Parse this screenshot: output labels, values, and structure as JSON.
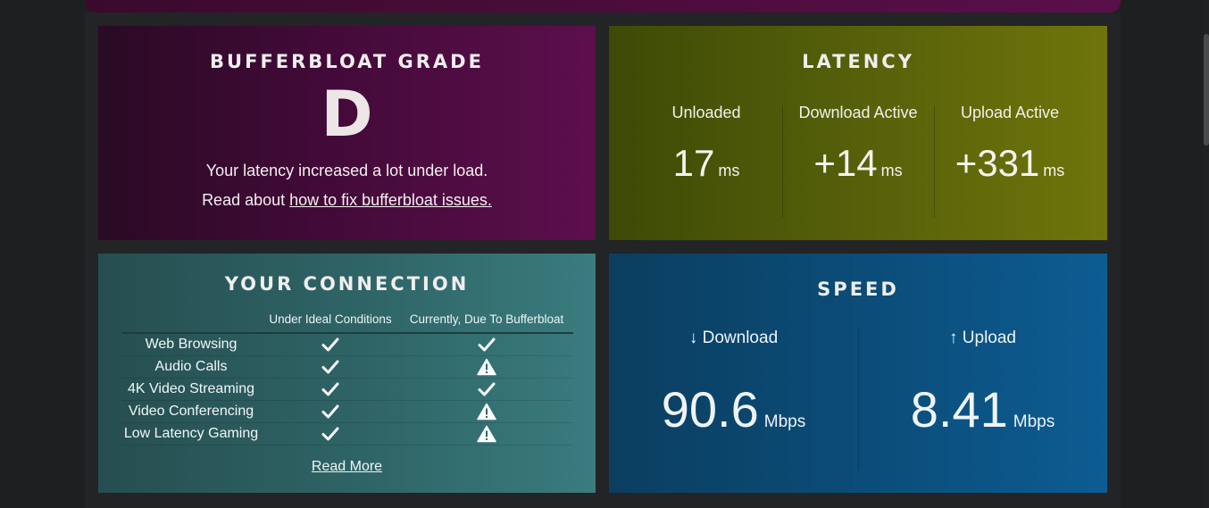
{
  "grade": {
    "title": "BUFFERBLOAT GRADE",
    "letter": "D",
    "description": "Your latency increased a lot under load.",
    "read_prefix": "Read about ",
    "read_link": "how to fix bufferbloat issues."
  },
  "latency": {
    "title": "LATENCY",
    "columns": [
      {
        "label": "Unloaded",
        "value": "17",
        "unit": "ms"
      },
      {
        "label": "Download Active",
        "value": "+14",
        "unit": "ms"
      },
      {
        "label": "Upload Active",
        "value": "+331",
        "unit": "ms"
      }
    ]
  },
  "connection": {
    "title": "YOUR CONNECTION",
    "headers": [
      "Under Ideal Conditions",
      "Currently, Due To Bufferbloat"
    ],
    "rows": [
      {
        "use": "Web Browsing",
        "ideal": "check-icon",
        "current": "check-icon"
      },
      {
        "use": "Audio Calls",
        "ideal": "check-icon",
        "current": "warning-icon"
      },
      {
        "use": "4K Video Streaming",
        "ideal": "check-icon",
        "current": "check-icon"
      },
      {
        "use": "Video Conferencing",
        "ideal": "check-icon",
        "current": "warning-icon"
      },
      {
        "use": "Low Latency Gaming",
        "ideal": "check-icon",
        "current": "warning-icon"
      }
    ],
    "read_more": "Read More"
  },
  "speed": {
    "title": "SPEED",
    "download": {
      "label": "↓ Download",
      "value": "90.6",
      "unit": "Mbps"
    },
    "upload": {
      "label": "↑ Upload",
      "value": "8.41",
      "unit": "Mbps"
    }
  },
  "colors": {
    "grade_bg": "#420a38",
    "latency_bg": "#56600a",
    "connection_bg": "#2f6567",
    "speed_bg": "#0b4c78"
  }
}
